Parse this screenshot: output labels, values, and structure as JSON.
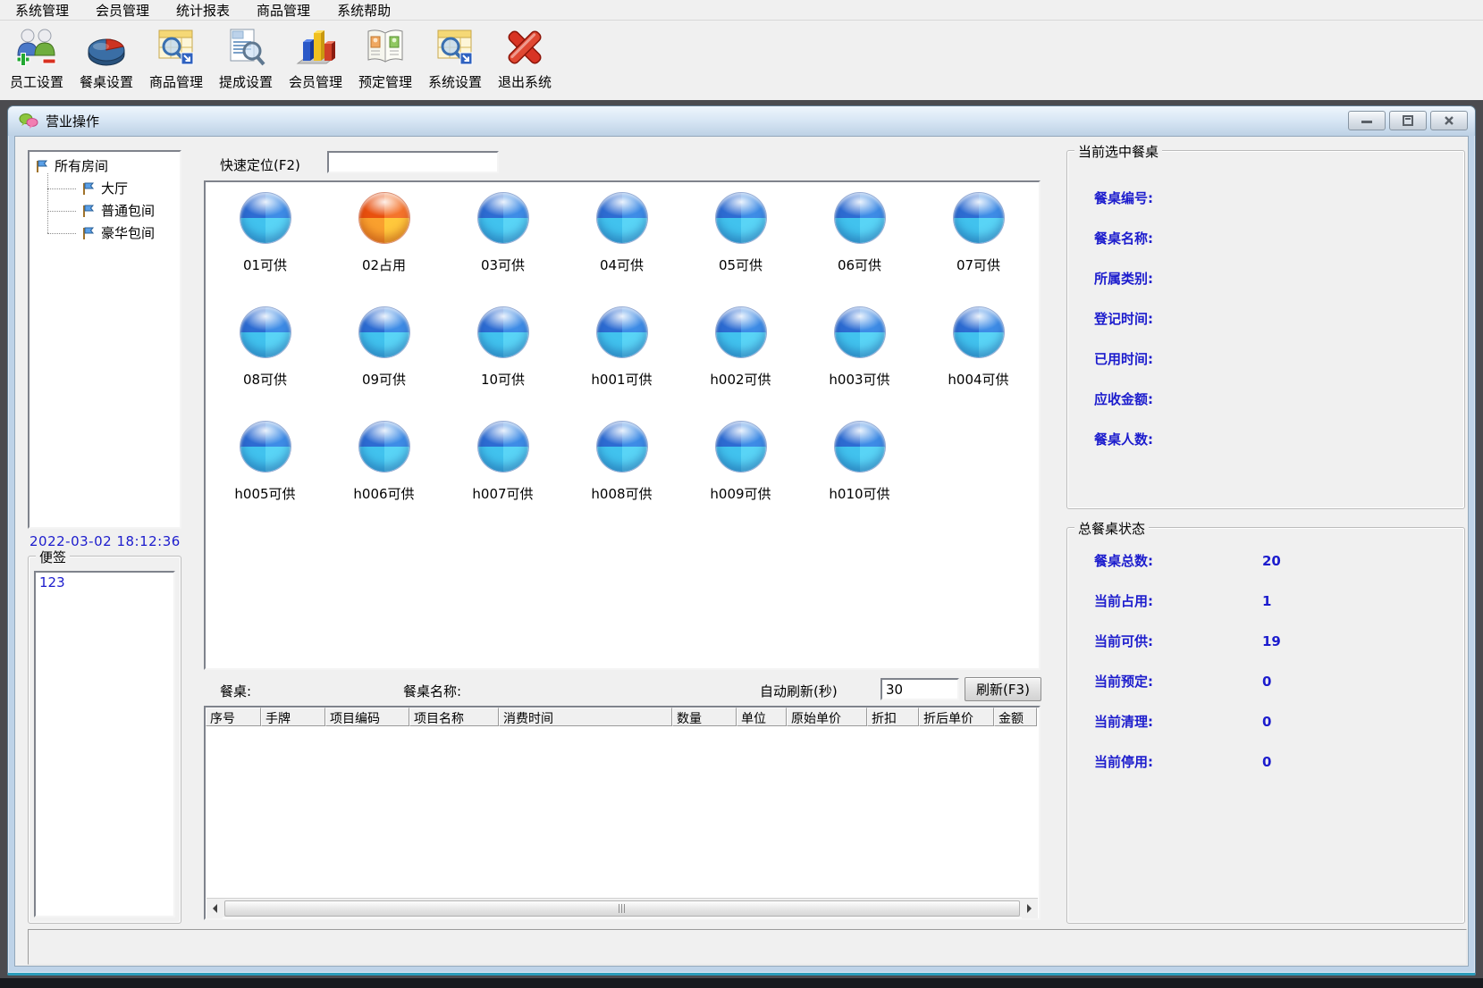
{
  "menu": {
    "items": [
      {
        "label": "系统管理"
      },
      {
        "label": "会员管理"
      },
      {
        "label": "统计报表"
      },
      {
        "label": "商品管理"
      },
      {
        "label": "系统帮助"
      }
    ]
  },
  "toolbar": {
    "buttons": [
      {
        "label": "员工设置",
        "icon": "employees-icon"
      },
      {
        "label": "餐桌设置",
        "icon": "table-setup-pie-icon"
      },
      {
        "label": "商品管理",
        "icon": "product-manage-icon"
      },
      {
        "label": "提成设置",
        "icon": "commission-doc-search-icon"
      },
      {
        "label": "会员管理",
        "icon": "member-barchart-icon"
      },
      {
        "label": "预定管理",
        "icon": "reservation-book-icon"
      },
      {
        "label": "系统设置",
        "icon": "system-settings-icon"
      },
      {
        "label": "退出系统",
        "icon": "exit-x-icon"
      }
    ]
  },
  "window": {
    "title": "营业操作"
  },
  "sidebar": {
    "tree_root": "所有房间",
    "tree_children": [
      {
        "label": "大厅"
      },
      {
        "label": "普通包间"
      },
      {
        "label": "豪华包间"
      }
    ],
    "timestamp": "2022-03-02 18:12:36",
    "note_label": "便签",
    "note_text": "123"
  },
  "main": {
    "quick_locate_label": "快速定位(F2)",
    "quick_locate_value": "",
    "tables": [
      {
        "label": "01可供",
        "status": "available"
      },
      {
        "label": "02占用",
        "status": "occupied"
      },
      {
        "label": "03可供",
        "status": "available"
      },
      {
        "label": "04可供",
        "status": "available"
      },
      {
        "label": "05可供",
        "status": "available"
      },
      {
        "label": "06可供",
        "status": "available"
      },
      {
        "label": "07可供",
        "status": "available"
      },
      {
        "label": "08可供",
        "status": "available"
      },
      {
        "label": "09可供",
        "status": "available"
      },
      {
        "label": "10可供",
        "status": "available"
      },
      {
        "label": "h001可供",
        "status": "available"
      },
      {
        "label": "h002可供",
        "status": "available"
      },
      {
        "label": "h003可供",
        "status": "available"
      },
      {
        "label": "h004可供",
        "status": "available"
      },
      {
        "label": "h005可供",
        "status": "available"
      },
      {
        "label": "h006可供",
        "status": "available"
      },
      {
        "label": "h007可供",
        "status": "available"
      },
      {
        "label": "h008可供",
        "status": "available"
      },
      {
        "label": "h009可供",
        "status": "available"
      },
      {
        "label": "h010可供",
        "status": "available"
      }
    ],
    "table_label": "餐桌:",
    "table_name_label": "餐桌名称:",
    "auto_refresh_label": "自动刷新(秒)",
    "auto_refresh_value": "30",
    "refresh_button": "刷新(F3)",
    "detail_columns": [
      {
        "label": "序号"
      },
      {
        "label": "手牌"
      },
      {
        "label": "项目编码"
      },
      {
        "label": "项目名称"
      },
      {
        "label": "消费时间"
      },
      {
        "label": "数量"
      },
      {
        "label": "单位"
      },
      {
        "label": "原始单价"
      },
      {
        "label": "折扣"
      },
      {
        "label": "折后单价"
      },
      {
        "label": "金额"
      }
    ],
    "detail_rows": []
  },
  "right_panel": {
    "selected_group": "当前选中餐桌",
    "selected_fields": [
      {
        "label": "餐桌编号:"
      },
      {
        "label": "餐桌名称:"
      },
      {
        "label": "所属类别:"
      },
      {
        "label": "登记时间:"
      },
      {
        "label": "已用时间:"
      },
      {
        "label": "应收金额:"
      },
      {
        "label": "餐桌人数:"
      }
    ],
    "status_group": "总餐桌状态",
    "status_rows": [
      {
        "label": "餐桌总数:",
        "value": "20"
      },
      {
        "label": "当前占用:",
        "value": "1"
      },
      {
        "label": "当前可供:",
        "value": "19"
      },
      {
        "label": "当前预定:",
        "value": "0"
      },
      {
        "label": "当前清理:",
        "value": "0"
      },
      {
        "label": "当前停用:",
        "value": "0"
      }
    ]
  },
  "colors": {
    "label_blue": "#1c1ccd",
    "available_table_blue": "#3e8ce6",
    "occupied_table_orange": "#f4742c",
    "window_border_blue": "#bed3e8",
    "window_bottom_teal": "#2b9cba"
  }
}
